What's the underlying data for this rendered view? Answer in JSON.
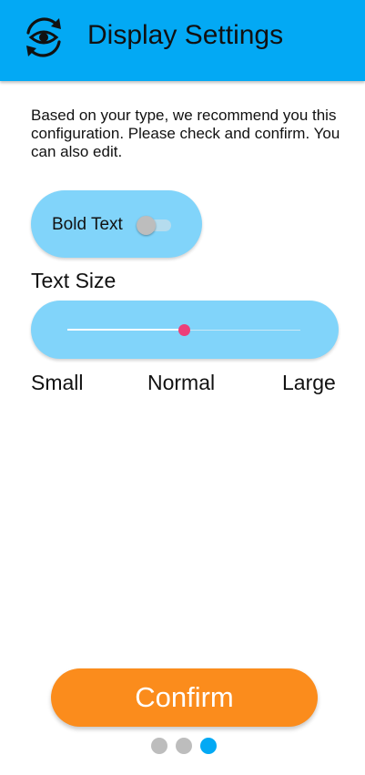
{
  "header": {
    "title": "Display Settings",
    "icon": "eye-sync-icon",
    "background_color": "#03a9f4"
  },
  "intro_text": "Based on your type, we recommend you this configuration. Please check and confirm. You can also edit.",
  "bold_text": {
    "label": "Bold Text",
    "enabled": false
  },
  "text_size": {
    "title": "Text Size",
    "value_fraction": 0.5,
    "labels": {
      "small": "Small",
      "normal": "Normal",
      "large": "Large"
    }
  },
  "confirm_label": "Confirm",
  "colors": {
    "accent": "#03a9f4",
    "card": "#81d4fa",
    "confirm": "#fb8c1c",
    "slider_thumb": "#ec407a",
    "dot_inactive": "#bdbdbd",
    "dot_active": "#03a9f4"
  },
  "pagination": {
    "total": 3,
    "current": 3
  }
}
